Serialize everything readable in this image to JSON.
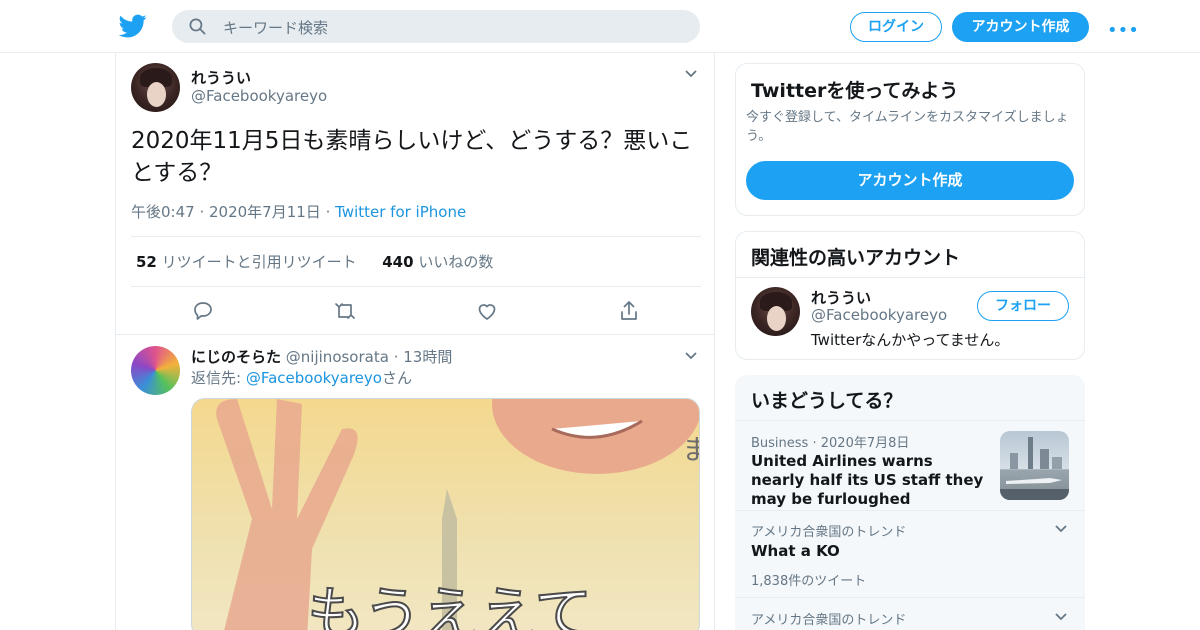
{
  "header": {
    "search_placeholder": "キーワード検索",
    "login_label": "ログイン",
    "signup_label": "アカウント作成",
    "more_label": "•••"
  },
  "tweet": {
    "display_name": "れううい",
    "handle": "@Facebookyareyo",
    "text": "2020年11月5日も素晴らしいけど、どうする？悪いことする？",
    "time": "午後0:47",
    "date": "2020年7月11日",
    "source": "Twitter for iPhone",
    "retweets_count": "52",
    "retweets_label": "リツイートと引用リツイート",
    "likes_count": "440",
    "likes_label": "いいねの数"
  },
  "reply": {
    "display_name": "にじのそらた",
    "handle": "@nijinosorata",
    "time": "13時間",
    "reply_prefix": "返信先: ",
    "reply_to": "@Facebookyareyo",
    "reply_suffix": "さん",
    "media_caption": "もうええて",
    "media_side_text": "ま"
  },
  "signup_card": {
    "title": "Twitterを使ってみよう",
    "description": "今すぐ登録して、タイムラインをカスタマイズしましょう。",
    "button": "アカウント作成"
  },
  "related_card": {
    "title": "関連性の高いアカウント",
    "display_name": "れううい",
    "handle": "@Facebookyareyo",
    "bio": "Twitterなんかやってません。",
    "follow_label": "フォロー"
  },
  "trends": {
    "title": "いまどうしてる？",
    "items": [
      {
        "category": "Business",
        "date": "2020年7月8日",
        "title": "United Airlines warns nearly half its US staff they may be furloughed"
      },
      {
        "category": "アメリカ合衆国のトレンド",
        "title": "What a KO",
        "count": "1,838件のツイート"
      },
      {
        "category": "アメリカ合衆国のトレンド"
      }
    ]
  },
  "colors": {
    "brand": "#1da1f2",
    "link": "#1b95e0",
    "secondary_text": "#657786",
    "border": "#e6ecf0"
  }
}
